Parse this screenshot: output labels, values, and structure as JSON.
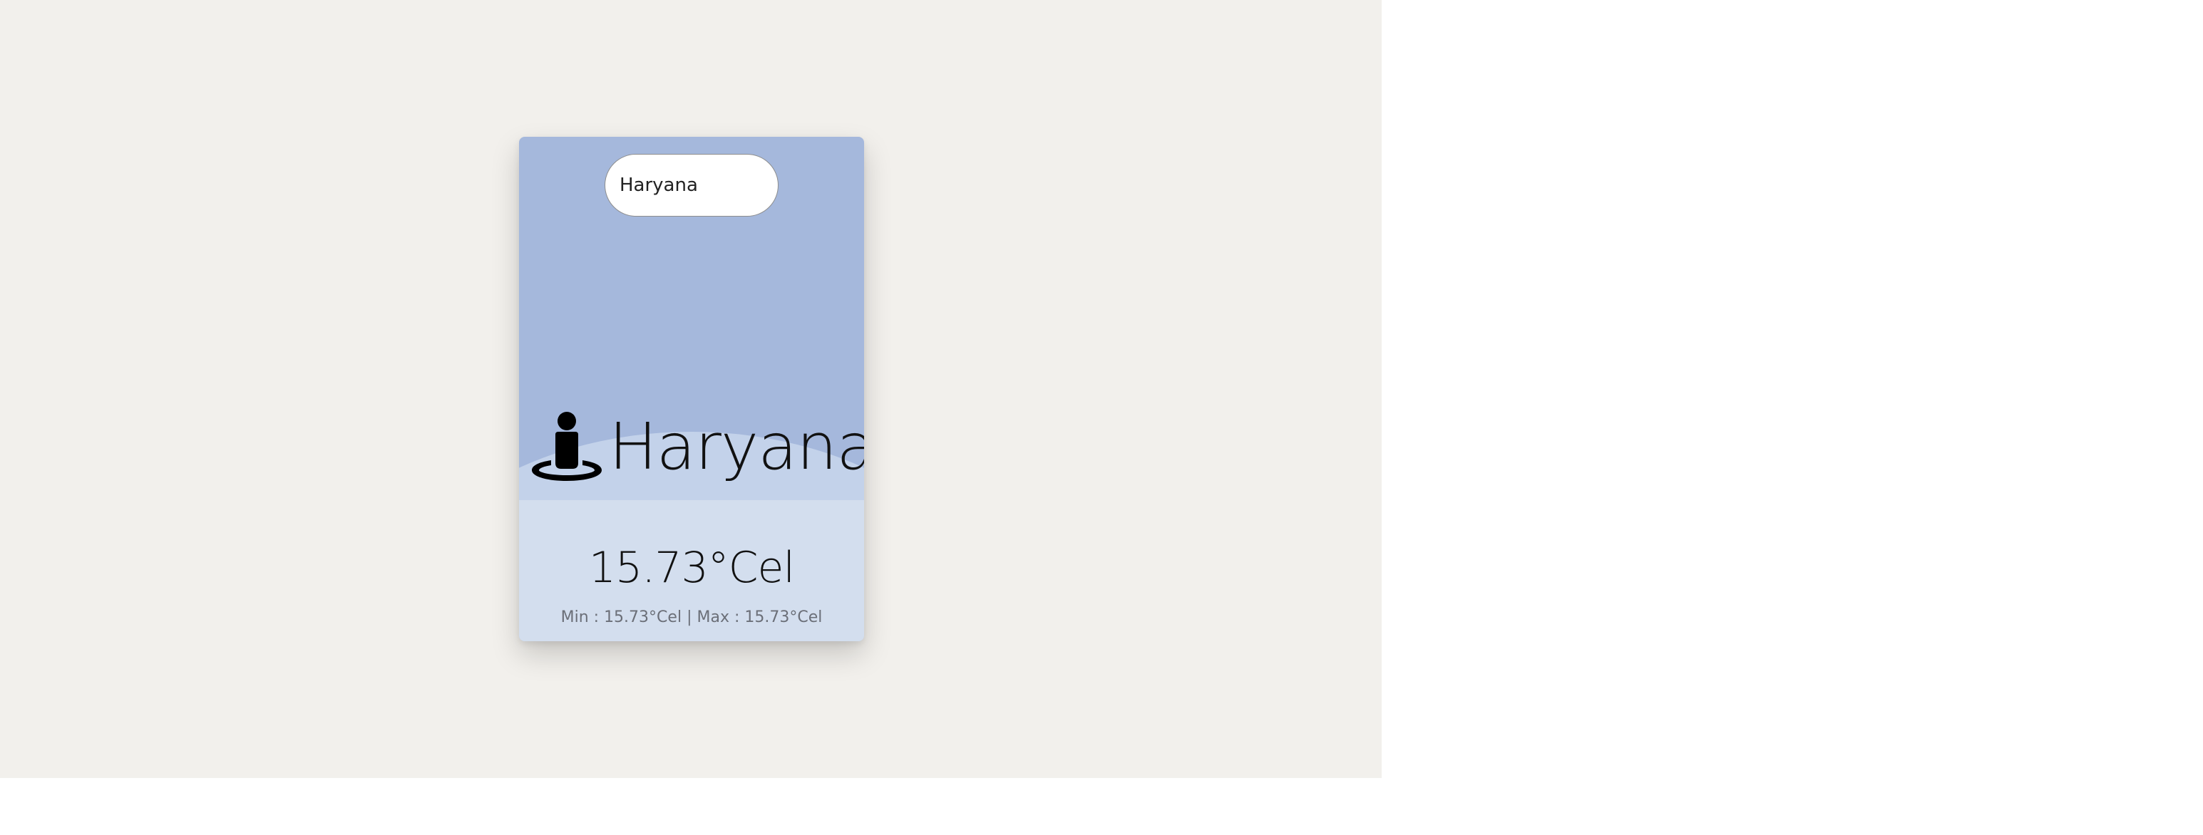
{
  "search": {
    "value": "Haryana",
    "placeholder": ""
  },
  "weather": {
    "city": "Haryana",
    "temperature": "15.73°Cel",
    "min_label": "Min",
    "min_value": "15.73°Cel",
    "max_label": "Max",
    "max_value": "15.73°Cel",
    "separator": ":",
    "divider": "|"
  },
  "icons": {
    "location": "person-pin-circle-icon"
  },
  "colors": {
    "page_background": "#f2f0ec",
    "card_top": "#a5b8dc",
    "card_wave": "#c3d2ea",
    "card_bottom": "#d3deee",
    "text_primary": "#111111",
    "text_secondary": "#6b6f78"
  }
}
